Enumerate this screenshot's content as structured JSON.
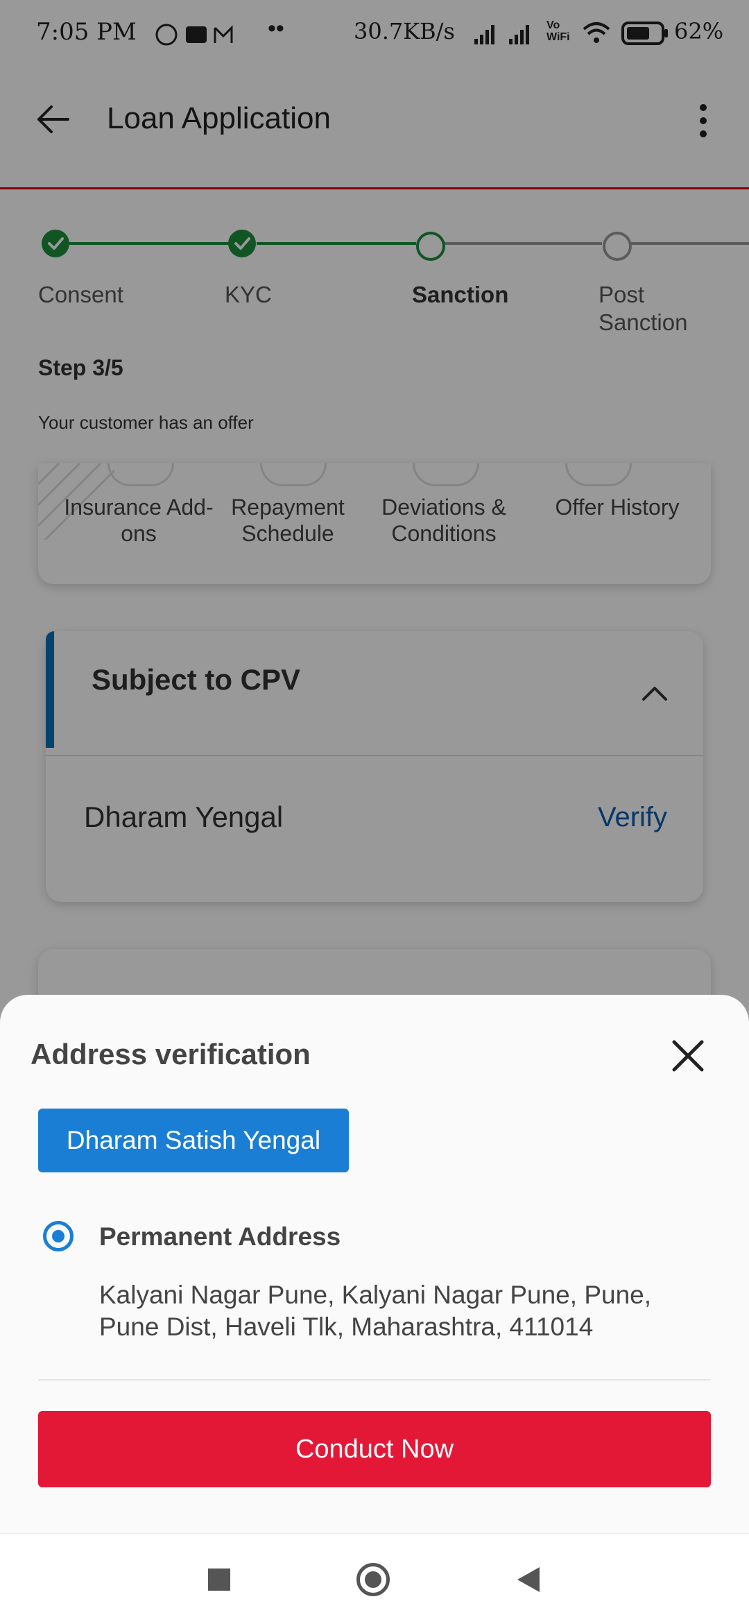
{
  "status_bar": {
    "time": "7:05 PM",
    "net_speed": "30.7KB/s",
    "volte_label": "Vo WiFi",
    "battery": "62%"
  },
  "app_bar": {
    "title": "Loan Application"
  },
  "stepper": {
    "steps": [
      {
        "label": "Consent",
        "state": "done"
      },
      {
        "label": "KYC",
        "state": "done"
      },
      {
        "label": "Sanction",
        "state": "current"
      },
      {
        "label": "Post\nSanction",
        "state": "pending"
      }
    ],
    "step_counter": "Step 3/5",
    "offer_text": "Your customer has an offer"
  },
  "offer_tiles": [
    "Insurance Add-\nons",
    "Repayment\nSchedule",
    "Deviations &\nConditions",
    "Offer History"
  ],
  "cpv_card": {
    "title": "Subject to CPV",
    "applicant": "Dharam Yengal",
    "verify_label": "Verify"
  },
  "sheet": {
    "title": "Address verification",
    "applicant_chip": "Dharam Satish Yengal",
    "address_type": "Permanent Address",
    "address": "Kalyani Nagar Pune, Kalyani Nagar Pune, Pune, Pune Dist, Haveli Tlk, Maharashtra, 411014",
    "cta": "Conduct Now"
  },
  "colors": {
    "brand_red": "#e31837",
    "chip_blue": "#1a7fd4",
    "success_green": "#1e8e3e",
    "link_blue": "#0b5cad"
  }
}
